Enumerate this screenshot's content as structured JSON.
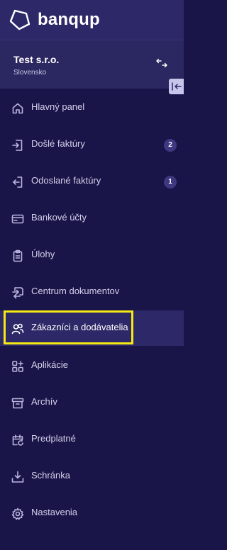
{
  "brand": {
    "name": "banqup"
  },
  "company": {
    "name": "Test s.r.o.",
    "country": "Slovensko"
  },
  "nav": {
    "items": [
      {
        "label": "Hlavný panel",
        "icon": "home-icon"
      },
      {
        "label": "Došlé faktúry",
        "icon": "inbox-arrow-icon",
        "badge": "2"
      },
      {
        "label": "Odoslané faktúry",
        "icon": "outbox-arrow-icon",
        "badge": "1"
      },
      {
        "label": "Bankové účty",
        "icon": "card-icon"
      },
      {
        "label": "Úlohy",
        "icon": "clipboard-icon"
      },
      {
        "label": "Centrum dokumentov",
        "icon": "documents-exchange-icon"
      },
      {
        "label": "Zákazníci a dodávatelia",
        "icon": "contacts-icon",
        "active": true
      },
      {
        "label": "Aplikácie",
        "icon": "apps-icon"
      },
      {
        "label": "Archív",
        "icon": "archive-icon"
      },
      {
        "label": "Predplatné",
        "icon": "subscription-calendar-icon"
      },
      {
        "label": "Schránka",
        "icon": "download-tray-icon"
      },
      {
        "label": "Nastavenia",
        "icon": "settings-icon"
      }
    ]
  },
  "colors": {
    "sidebar_bg": "#1a1548",
    "header_bg": "#2d2867",
    "active_bg": "#2d2867",
    "highlight": "#f5ea13",
    "badge_bg": "#3d3880"
  }
}
